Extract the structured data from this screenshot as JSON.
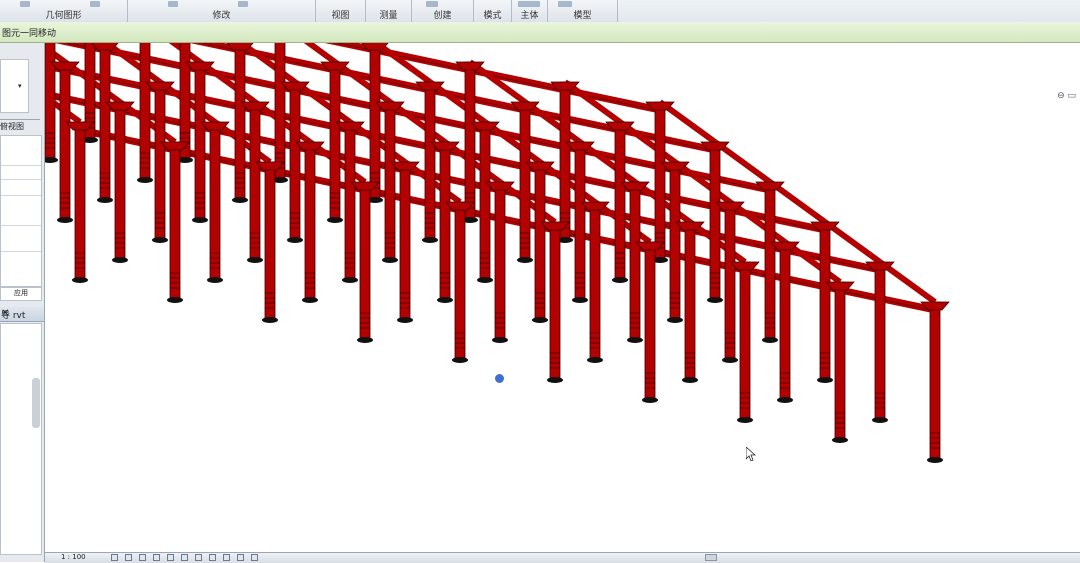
{
  "ribbon": {
    "panels": [
      {
        "id": "geometry",
        "label": "几何图形"
      },
      {
        "id": "modify",
        "label": "修改"
      },
      {
        "id": "view",
        "label": "视图"
      },
      {
        "id": "measure",
        "label": "测量"
      },
      {
        "id": "create",
        "label": "创建"
      },
      {
        "id": "mode",
        "label": "模式"
      },
      {
        "id": "host",
        "label": "主体"
      },
      {
        "id": "model",
        "label": "模型"
      }
    ]
  },
  "options_bar": {
    "text": "图元一同移动"
  },
  "left_panel": {
    "view_label": "俯视图",
    "browser_title": "导 rvt",
    "apply_button": "应用"
  },
  "view_bar": {
    "scale": "1 : 100"
  },
  "colors": {
    "structure": "#b30000",
    "base": "#111111",
    "ribbon": "#dde3ea",
    "options_bar": "#d3e8bf"
  }
}
